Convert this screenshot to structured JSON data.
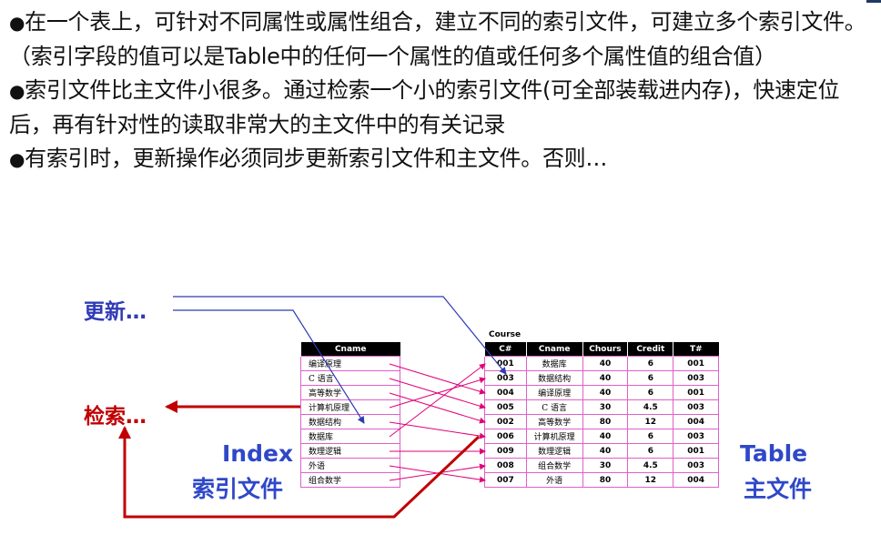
{
  "bullets": [
    {
      "dot": "●",
      "text": "在一个表上，可针对不同属性或属性组合，建立不同的索引文件，可建立多个索引文件。（索引字段的值可以是Table中的任何一个属性的值或任何多个属性值的组合值）"
    },
    {
      "dot": "●",
      "text": "索引文件比主文件小很多。通过检索一个小的索引文件(可全部装载进内存)，快速定位后，再有针对性的读取非常大的主文件中的有关记录"
    },
    {
      "dot": "●",
      "text": "有索引时，更新操作必须同步更新索引文件和主文件。否则…"
    }
  ],
  "labels": {
    "update": "更新…",
    "retrieve": "检索…",
    "index_en": "Index",
    "index_cn": "索引文件",
    "table_en": "Table",
    "table_cn": "主文件",
    "course": "Course"
  },
  "index_table": {
    "header": "Cname",
    "rows": [
      "编译原理",
      "C 语言",
      "高等数学",
      "计算机原理",
      "数据结构",
      "数据库",
      "数理逻辑",
      "外语",
      "组合数学"
    ]
  },
  "main_table": {
    "headers": [
      "C#",
      "Cname",
      "Chours",
      "Credit",
      "T#"
    ],
    "rows": [
      [
        "001",
        "数据库",
        "40",
        "6",
        "001"
      ],
      [
        "003",
        "数据结构",
        "40",
        "6",
        "003"
      ],
      [
        "004",
        "编译原理",
        "40",
        "6",
        "001"
      ],
      [
        "005",
        "C 语言",
        "30",
        "4.5",
        "003"
      ],
      [
        "002",
        "高等数学",
        "80",
        "12",
        "004"
      ],
      [
        "006",
        "计算机原理",
        "40",
        "6",
        "003"
      ],
      [
        "009",
        "数理逻辑",
        "40",
        "6",
        "001"
      ],
      [
        "008",
        "组合数学",
        "30",
        "4.5",
        "003"
      ],
      [
        "007",
        "外语",
        "80",
        "12",
        "004"
      ]
    ]
  },
  "index_pointers": [
    2,
    3,
    4,
    1,
    5,
    0,
    6,
    8,
    7
  ],
  "colors": {
    "update": "#2f3bb5",
    "retrieve": "#c00000",
    "pointer": "#e0007a",
    "blue_text": "#2f48c8"
  }
}
